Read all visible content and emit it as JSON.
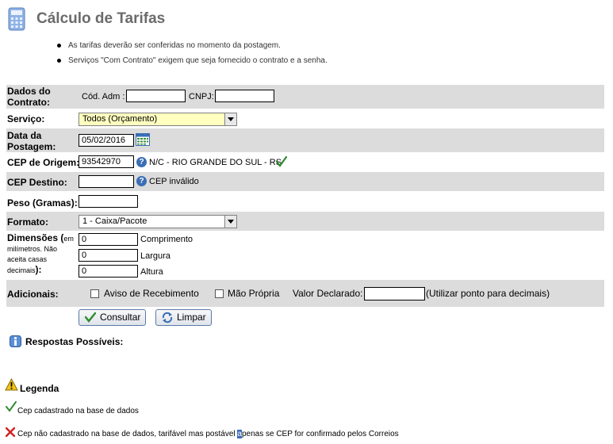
{
  "header": {
    "title": "Cálculo de Tarifas",
    "icon": "calculator-icon"
  },
  "notes": [
    "As tarifas deverão ser conferidas no momento da postagem.",
    "Serviços \"Com Contrato\" exigem que seja fornecido o contrato e a senha."
  ],
  "form": {
    "contrato": {
      "label_line1": "Dados do",
      "label_line2": "Contrato:",
      "cod_adm_label": "Cód. Adm :",
      "cod_adm_value": "",
      "cnpj_label": "CNPJ:",
      "cnpj_value": ""
    },
    "servico": {
      "label": "Serviço:",
      "value": "Todos (Orçamento)"
    },
    "data": {
      "label_line1": "Data da",
      "label_line2": "Postagem:",
      "value": "05/02/2016"
    },
    "cep_origem": {
      "label": "CEP de Origem:",
      "value": "93542970",
      "info": "N/C - RIO GRANDE DO SUL - RS"
    },
    "cep_destino": {
      "label": "CEP Destino:",
      "value": "",
      "info": "CEP inválido"
    },
    "peso": {
      "label_bold": "Peso",
      "label_paren": " (Gramas):",
      "value": ""
    },
    "formato": {
      "label": "Formato:",
      "value": "1 - Caixa/Pacote"
    },
    "dimensoes": {
      "label_bold": "Dimensões (",
      "label_small_1": "em",
      "label_small_2": "milímetros. Não",
      "label_small_3": "aceita casas",
      "label_small_4": "decimais",
      "label_end": "):",
      "comprimento": {
        "value": "0",
        "label": "Comprimento"
      },
      "largura": {
        "value": "0",
        "label": "Largura"
      },
      "altura": {
        "value": "0",
        "label": "Altura"
      }
    },
    "adicionais": {
      "label": "Adicionais:",
      "aviso": "Aviso de Recebimento",
      "mao_propria": "Mão Própria",
      "valor_label": "Valor Declarado:",
      "valor_value": "",
      "hint": "(Utilizar ponto para decimais)"
    }
  },
  "buttons": {
    "consultar": "Consultar",
    "limpar": "Limpar"
  },
  "respostas": {
    "label": "Respostas Possíveis:"
  },
  "legenda": {
    "title": "Legenda",
    "ok": "Cep cadastrado na base de dados",
    "warn_before": "Cep não cadastrado na base de dados, tarifável mas postável ",
    "warn_highlight": "a",
    "warn_after": "penas se CEP for confirmado pelos Correios"
  },
  "colors": {
    "band": "#dcdcdc",
    "select_yellow": "#ffffc0",
    "check_green": "#2e8b2e",
    "cross_red": "#d22020"
  }
}
